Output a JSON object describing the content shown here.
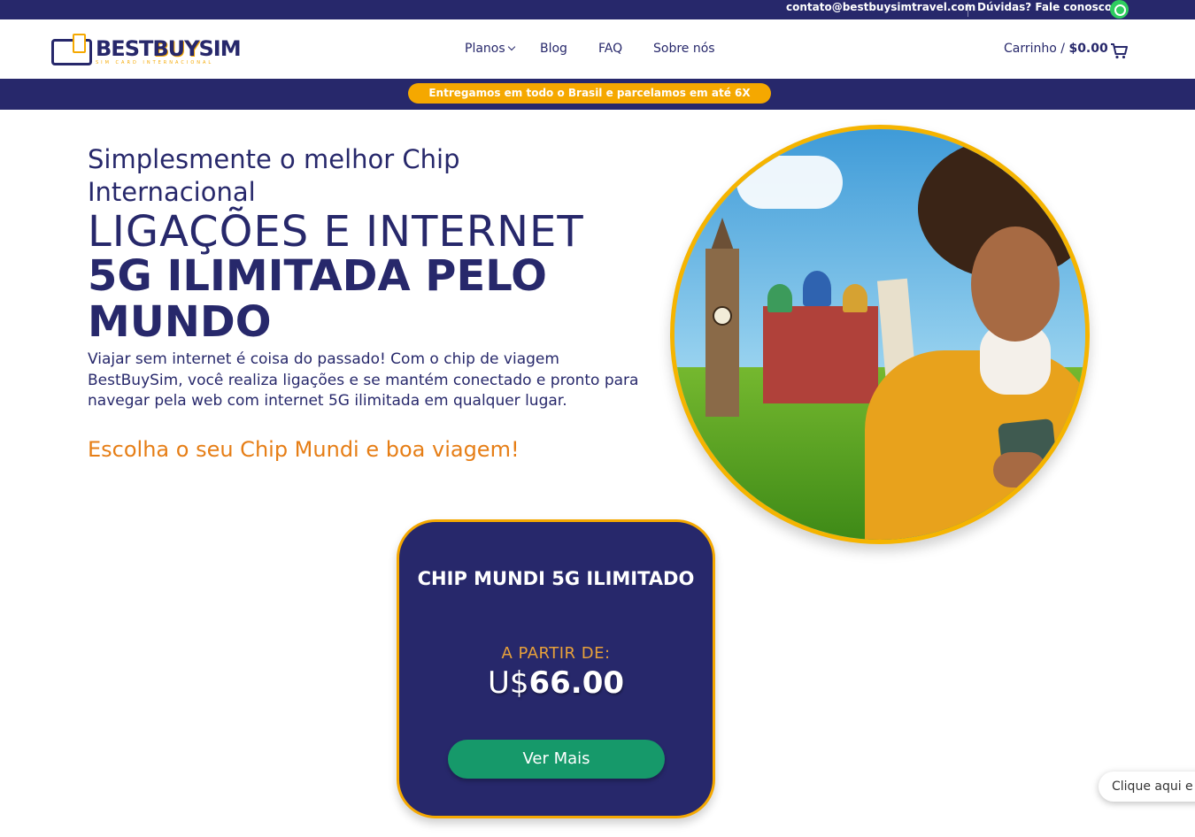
{
  "topbar": {
    "email": "contato@bestbuysimtravel.com",
    "help_text": "Dúvidas? Fale conosco!",
    "whatsapp_icon": "whatsapp-icon",
    "bg_color": "#27286b"
  },
  "header": {
    "logo": {
      "brand_best": "BEST",
      "brand_buy": "BUY",
      "brand_sim": "SIM",
      "tagline": "SIM CARD INTERNACIONAL"
    },
    "nav": {
      "planos": "Planos",
      "blog": "Blog",
      "faq": "FAQ",
      "sobre": "Sobre nós"
    },
    "cart": {
      "label": "Carrinho /",
      "total": "$0.00",
      "icon": "cart-icon"
    }
  },
  "promo": {
    "text": "Entregamos em todo o Brasil e parcelamos em até 6X",
    "color": "#f5a800"
  },
  "hero": {
    "subtitle": "Simplesmente o melhor Chip Internacional",
    "headline_light": "LIGAÇÕES E INTERNET",
    "headline_bold": "5G ILIMITADA PELO MUNDO",
    "description": "Viajar sem internet é coisa do passado! Com o chip de viagem BestBuySim, você realiza ligações e se mantém conectado e pronto para navegar pela web com internet 5G ilimitada em qualquer lugar.",
    "cta_text": "Escolha o seu Chip Mundi e boa viagem!",
    "accent_color": "#e67e16"
  },
  "product_card": {
    "title": "CHIP MUNDI 5G ILIMITADO",
    "from_label": "A PARTIR DE:",
    "currency": "U$",
    "price": "66.00",
    "button_label": "Ver Mais",
    "button_color": "#16996a"
  },
  "chat": {
    "label": "Clique aqui e"
  }
}
